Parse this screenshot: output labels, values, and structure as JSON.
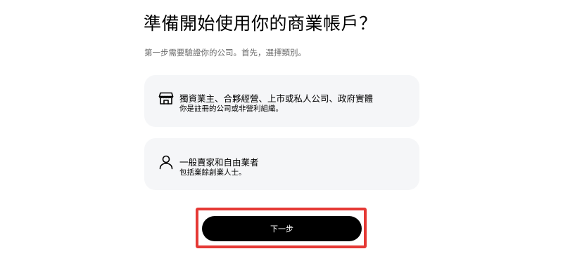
{
  "page": {
    "title": "準備開始使用你的商業帳戶？",
    "subtitle": "第一步需要驗證你的公司。首先，選擇類別。"
  },
  "options": [
    {
      "title": "獨資業主、合夥經營、上市或私人公司、政府實體",
      "description": "你是註冊的公司或非營利組織。",
      "icon": "storefront-icon"
    },
    {
      "title": "一般賣家和自由業者",
      "description": "包括業餘創業人士。",
      "icon": "person-icon"
    }
  ],
  "actions": {
    "next_label": "下一步"
  },
  "colors": {
    "card_background": "#f5f6f8",
    "button_background": "#000000",
    "button_text": "#ffffff",
    "highlight_border": "#e53935",
    "subtitle_text": "#6b6b6b"
  }
}
